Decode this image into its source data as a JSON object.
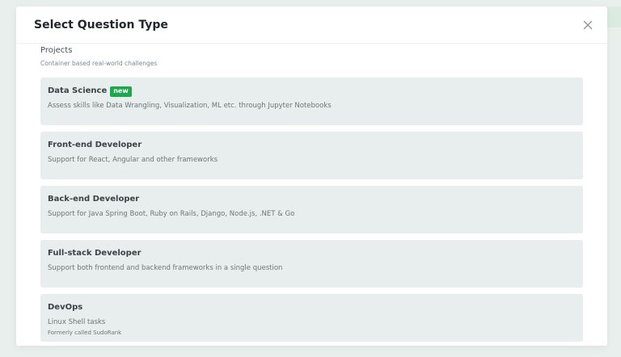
{
  "modal": {
    "title": "Select Question Type"
  },
  "section": {
    "title": "Projects",
    "subtitle": "Container based real-world challenges"
  },
  "cards": [
    {
      "title": "Data Science",
      "badge": "new",
      "description": "Assess skills like Data Wrangling, Visualization, ML etc. through Jupyter Notebooks"
    },
    {
      "title": "Front-end Developer",
      "description": "Support for React, Angular and other frameworks"
    },
    {
      "title": "Back-end Developer",
      "description": "Support for Java Spring Boot, Ruby on Rails, Django, Node.js, .NET & Go"
    },
    {
      "title": "Full-stack Developer",
      "description": "Support both frontend and backend frameworks in a single question"
    },
    {
      "title": "DevOps",
      "description": "Linux Shell tasks",
      "note": "Formerly called SudoRank"
    }
  ],
  "colors": {
    "badge": "#1ba94c",
    "card_bg": "#e8eded",
    "title": "#20272b"
  },
  "icons": {
    "close": "close-icon"
  }
}
